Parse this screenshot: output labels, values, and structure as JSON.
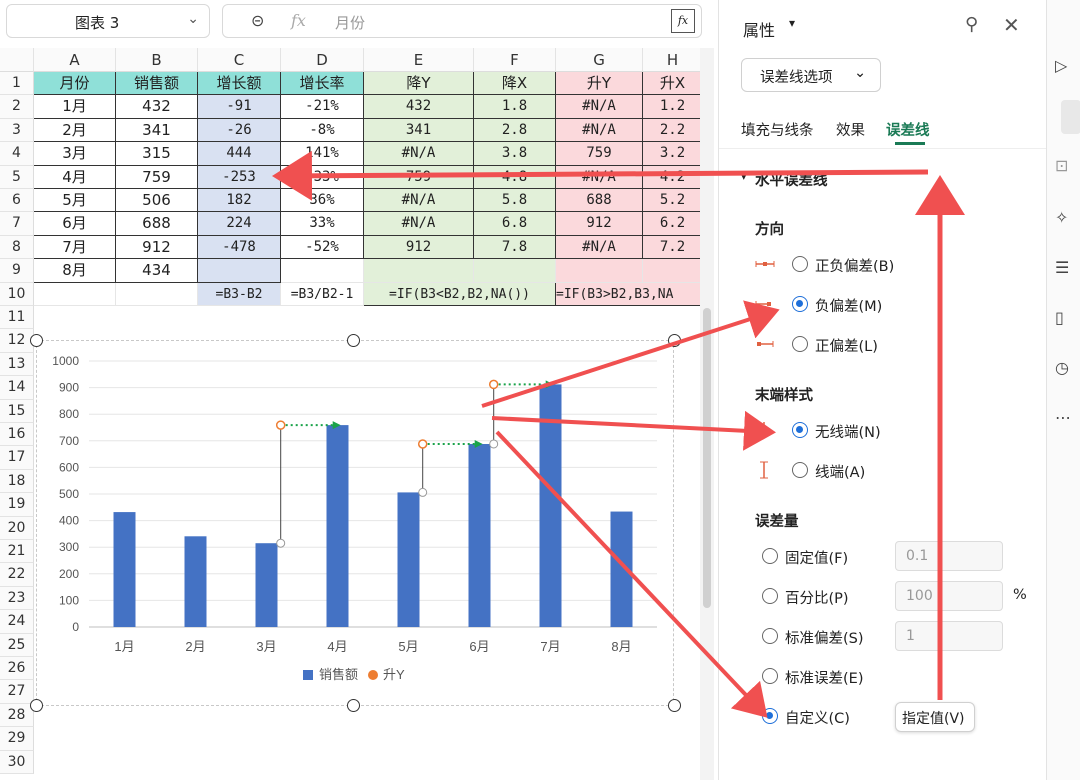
{
  "namebox": {
    "value": "图表 3"
  },
  "formula": {
    "value": "月份"
  },
  "columns": [
    "A",
    "B",
    "C",
    "D",
    "E",
    "F",
    "G",
    "H"
  ],
  "rows": [
    "1",
    "2",
    "3",
    "4",
    "5",
    "6",
    "7",
    "8",
    "9",
    "10",
    "11",
    "12",
    "13",
    "14",
    "15",
    "16",
    "17",
    "18",
    "19",
    "20",
    "21",
    "22",
    "23",
    "24",
    "25",
    "26",
    "27",
    "28",
    "29",
    "30"
  ],
  "table": {
    "header": [
      "月份",
      "销售额",
      "增长额",
      "增长率",
      "降Y",
      "降X",
      "升Y",
      "升X"
    ],
    "rows": [
      [
        "1月",
        "432",
        "-91",
        "-21%",
        "432",
        "1.8",
        "#N/A",
        "1.2"
      ],
      [
        "2月",
        "341",
        "-26",
        "-8%",
        "341",
        "2.8",
        "#N/A",
        "2.2"
      ],
      [
        "3月",
        "315",
        "444",
        "141%",
        "#N/A",
        "3.8",
        "759",
        "3.2"
      ],
      [
        "4月",
        "759",
        "-253",
        "-33%",
        "759",
        "4.8",
        "#N/A",
        "4.2"
      ],
      [
        "5月",
        "506",
        "182",
        "36%",
        "#N/A",
        "5.8",
        "688",
        "5.2"
      ],
      [
        "6月",
        "688",
        "224",
        "33%",
        "#N/A",
        "6.8",
        "912",
        "6.2"
      ],
      [
        "7月",
        "912",
        "-478",
        "-52%",
        "912",
        "7.8",
        "#N/A",
        "7.2"
      ],
      [
        "8月",
        "434",
        "",
        "",
        "",
        "",
        "",
        ""
      ]
    ],
    "formulas": [
      "",
      "",
      "=B3-B2",
      "=B3/B2-1",
      "=IF(B3<B2,B2,NA())",
      "",
      "=IF(B3>B2,B3,NA",
      ""
    ]
  },
  "colors": {
    "bar": "#4472c4",
    "point": "#ed7d31",
    "arrow_green": "#1aa34a",
    "callout_red": "#f05050",
    "accent": "#1e6fd9",
    "hdr_cyan": "#8fe0d8",
    "col_c": "#d9e1f2",
    "col_ef": "#e2f0d9",
    "col_gh": "#fbd9dc"
  },
  "chart_data": {
    "type": "bar",
    "categories": [
      "1月",
      "2月",
      "3月",
      "4月",
      "5月",
      "6月",
      "7月",
      "8月"
    ],
    "series": [
      {
        "name": "销售额",
        "values": [
          432,
          341,
          315,
          759,
          506,
          688,
          912,
          434
        ]
      },
      {
        "name": "升Y",
        "type": "scatter",
        "x": [
          3.2,
          5.2,
          6.2
        ],
        "values": [
          759,
          688,
          912
        ]
      }
    ],
    "error_bars": [
      {
        "x": 3.2,
        "from": 315,
        "to": 759
      },
      {
        "x": 5.2,
        "from": 506,
        "to": 688
      },
      {
        "x": 6.2,
        "from": 688,
        "to": 912
      }
    ],
    "ylim": [
      0,
      1000
    ],
    "yticks": [
      "0",
      "100",
      "200",
      "300",
      "400",
      "500",
      "600",
      "700",
      "800",
      "900",
      "1000"
    ],
    "legend_position": "bottom",
    "grid": true
  },
  "panel": {
    "title": "属性",
    "dropdown": "误差线选项",
    "tabs": [
      "填充与线条",
      "效果",
      "误差线"
    ],
    "active_tab": "误差线",
    "section_h_error": "水平误差线",
    "direction_title": "方向",
    "direction": [
      "正负偏差(B)",
      "负偏差(M)",
      "正偏差(L)"
    ],
    "end_style_title": "末端样式",
    "end_style": [
      "无线端(N)",
      "线端(A)"
    ],
    "amount_title": "误差量",
    "amount": [
      "固定值(F)",
      "百分比(P)",
      "标准偏差(S)",
      "标准误差(E)",
      "自定义(C)"
    ],
    "fixed_value": "0.1",
    "percent_value": "100",
    "percent_unit": "%",
    "stddev_value": "1",
    "specify_button": "指定值(V)"
  }
}
